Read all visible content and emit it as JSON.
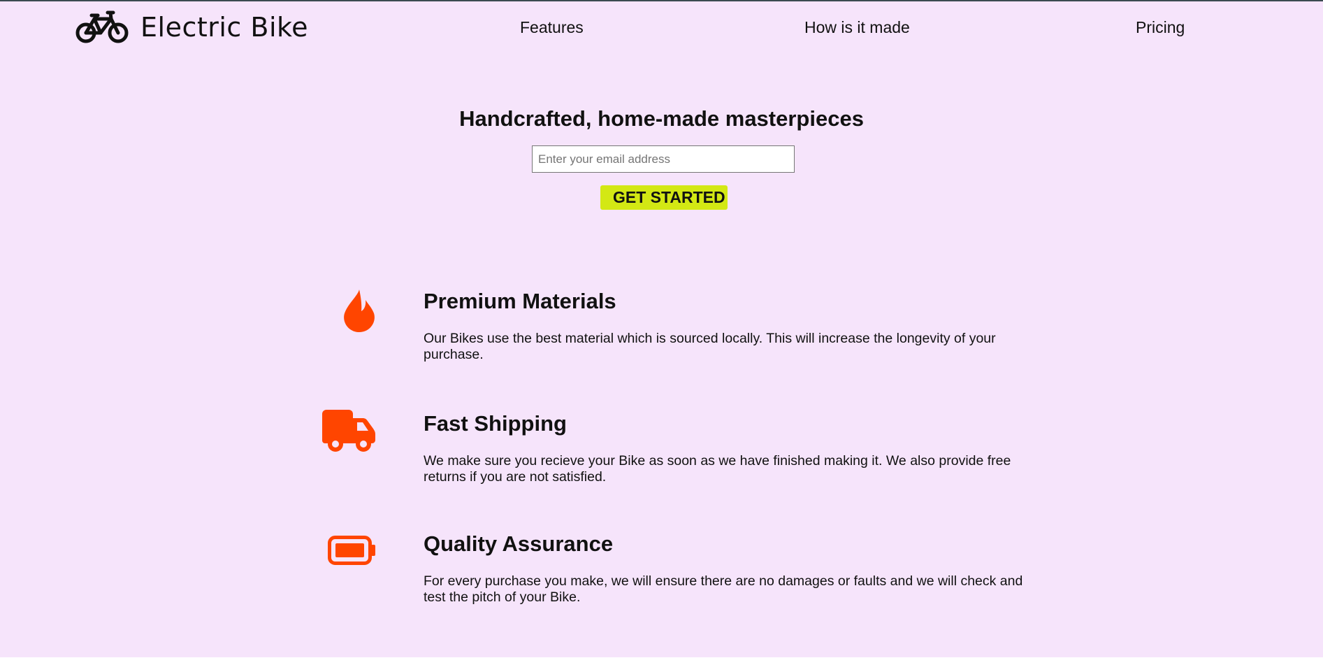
{
  "brand": {
    "name": "Electric Bike",
    "logo_icon": "bicycle-icon"
  },
  "nav": {
    "items": [
      {
        "label": "Features"
      },
      {
        "label": "How is it made"
      },
      {
        "label": "Pricing"
      }
    ]
  },
  "hero": {
    "title": "Handcrafted, home-made masterpieces",
    "email_placeholder": "Enter your email address",
    "email_value": "",
    "cta_label": "GET STARTED"
  },
  "features": [
    {
      "icon": "flame-icon",
      "title": "Premium Materials",
      "text": "Our Bikes use the best material which is sourced locally. This will increase the longevity of your purchase."
    },
    {
      "icon": "truck-icon",
      "title": "Fast Shipping",
      "text": "We make sure you recieve your Bike as soon as we have finished making it. We also provide free returns if you are not satisfied."
    },
    {
      "icon": "battery-icon",
      "title": "Quality Assurance",
      "text": "For every purchase you make, we will ensure there are no damages or faults and we will check and test the pitch of your Bike."
    }
  ],
  "colors": {
    "background": "#f6e4fb",
    "accent_icon": "#ff4500",
    "cta_background": "#d3e814",
    "text": "#111111"
  }
}
